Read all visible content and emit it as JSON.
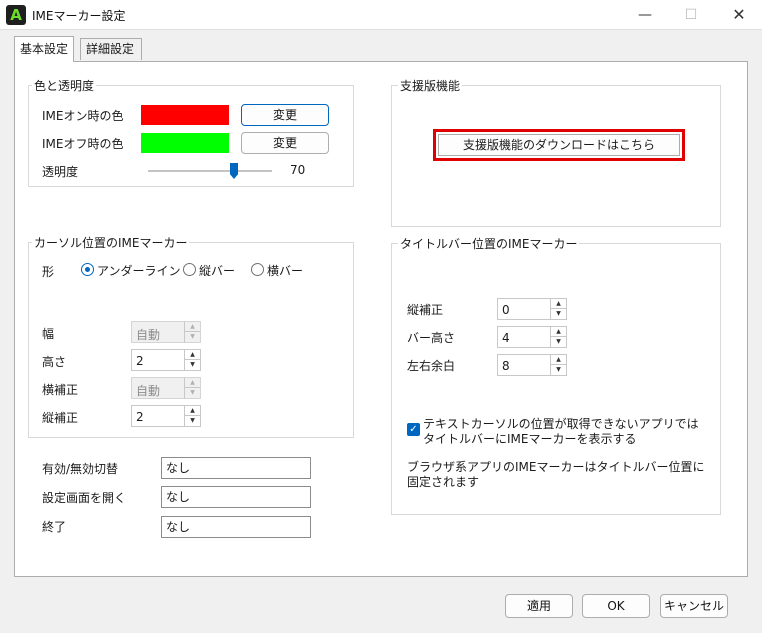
{
  "window": {
    "icon_letter": "A",
    "title": "IMEマーカー設定",
    "minimize": "—",
    "maximize": "☐",
    "close": "✕"
  },
  "tabs": [
    {
      "label": "基本設定",
      "active": true
    },
    {
      "label": "詳細設定",
      "active": false
    }
  ],
  "color_group": {
    "title": "色と透明度",
    "ime_on_label": "IMEオン時の色",
    "ime_on_color": "#ff0000",
    "ime_off_label": "IMEオフ時の色",
    "ime_off_color": "#00ff00",
    "change_label": "変更",
    "opacity_label": "透明度",
    "opacity_value": "70"
  },
  "support_group": {
    "title": "支援版機能",
    "download_button": "支援版機能のダウンロードはこちら"
  },
  "cursor_group": {
    "title": "カーソル位置のIMEマーカー",
    "shape_label": "形",
    "shape_options": [
      "アンダーライン",
      "縦バー",
      "横バー"
    ],
    "shape_selected": "アンダーライン",
    "width_label": "幅",
    "width_value": "自動",
    "height_label": "高さ",
    "height_value": "2",
    "h_offset_label": "横補正",
    "h_offset_value": "自動",
    "v_offset_label": "縦補正",
    "v_offset_value": "2"
  },
  "titlebar_group": {
    "title": "タイトルバー位置のIMEマーカー",
    "v_offset_label": "縦補正",
    "v_offset_value": "0",
    "bar_height_label": "バー高さ",
    "bar_height_value": "4",
    "margin_label": "左右余白",
    "margin_value": "8",
    "checkbox_line1": "テキストカーソルの位置が取得できないアプリでは",
    "checkbox_line2": "タイトルバーにIMEマーカーを表示する",
    "checkbox_checked": true,
    "note_line1": "ブラウザ系アプリのIMEマーカーはタイトルバー位置に",
    "note_line2": "固定されます"
  },
  "hotkeys": {
    "toggle_label": "有効/無効切替",
    "toggle_value": "なし",
    "open_settings_label": "設定画面を開く",
    "open_settings_value": "なし",
    "exit_label": "終了",
    "exit_value": "なし"
  },
  "footer": {
    "apply": "適用",
    "ok": "OK",
    "cancel": "キャンセル"
  }
}
